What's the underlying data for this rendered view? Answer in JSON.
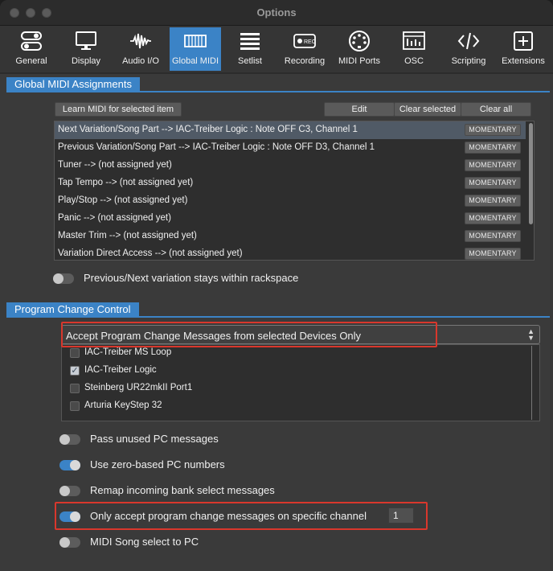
{
  "window": {
    "title": "Options"
  },
  "toolbar": {
    "tabs": [
      {
        "label": "General",
        "icon": "toggles-icon"
      },
      {
        "label": "Display",
        "icon": "monitor-icon"
      },
      {
        "label": "Audio I/O",
        "icon": "waveform-icon"
      },
      {
        "label": "Global MIDI",
        "icon": "keyboard-icon",
        "active": true
      },
      {
        "label": "Setlist",
        "icon": "list-icon"
      },
      {
        "label": "Recording",
        "icon": "record-icon"
      },
      {
        "label": "MIDI Ports",
        "icon": "midi-port-icon"
      },
      {
        "label": "OSC",
        "icon": "osc-icon"
      },
      {
        "label": "Scripting",
        "icon": "code-icon"
      },
      {
        "label": "Extensions",
        "icon": "plus-box-icon"
      }
    ]
  },
  "global_midi": {
    "section_title": "Global MIDI Assignments",
    "learn_button": "Learn MIDI for selected item",
    "edit_button": "Edit",
    "clear_selected_button": "Clear selected",
    "clear_all_button": "Clear all",
    "mode_label": "MOMENTARY",
    "assignments": [
      {
        "text": "Next Variation/Song Part --> IAC-Treiber Logic : Note OFF C3, Channel 1",
        "selected": true
      },
      {
        "text": "Previous Variation/Song Part --> IAC-Treiber Logic : Note OFF D3, Channel 1"
      },
      {
        "text": "Tuner --> (not assigned yet)"
      },
      {
        "text": "Tap Tempo --> (not assigned yet)"
      },
      {
        "text": "Play/Stop --> (not assigned yet)"
      },
      {
        "text": "Panic --> (not assigned yet)"
      },
      {
        "text": "Master Trim --> (not assigned yet)"
      },
      {
        "text": "Variation Direct Access --> (not assigned yet)"
      }
    ],
    "stay_within_rackspace": {
      "label": "Previous/Next variation stays within rackspace",
      "on": false
    }
  },
  "program_change": {
    "section_title": "Program Change Control",
    "mode_select": "Accept Program Change Messages from selected Devices Only",
    "devices": [
      {
        "name": "IAC-Treiber MS Loop",
        "checked": false
      },
      {
        "name": "IAC-Treiber Logic",
        "checked": true
      },
      {
        "name": "Steinberg UR22mkII  Port1",
        "checked": false
      },
      {
        "name": "Arturia KeyStep 32",
        "checked": false
      }
    ],
    "options": [
      {
        "label": "Pass unused PC messages",
        "on": false
      },
      {
        "label": "Use zero-based PC numbers",
        "on": true
      },
      {
        "label": "Remap incoming bank select messages",
        "on": false
      },
      {
        "label": "Only accept program change messages on specific channel",
        "on": true
      },
      {
        "label": "MIDI Song select to PC",
        "on": false
      }
    ],
    "channel_value": "1"
  },
  "colors": {
    "accent": "#3b83c6",
    "highlight": "#d9372c"
  }
}
